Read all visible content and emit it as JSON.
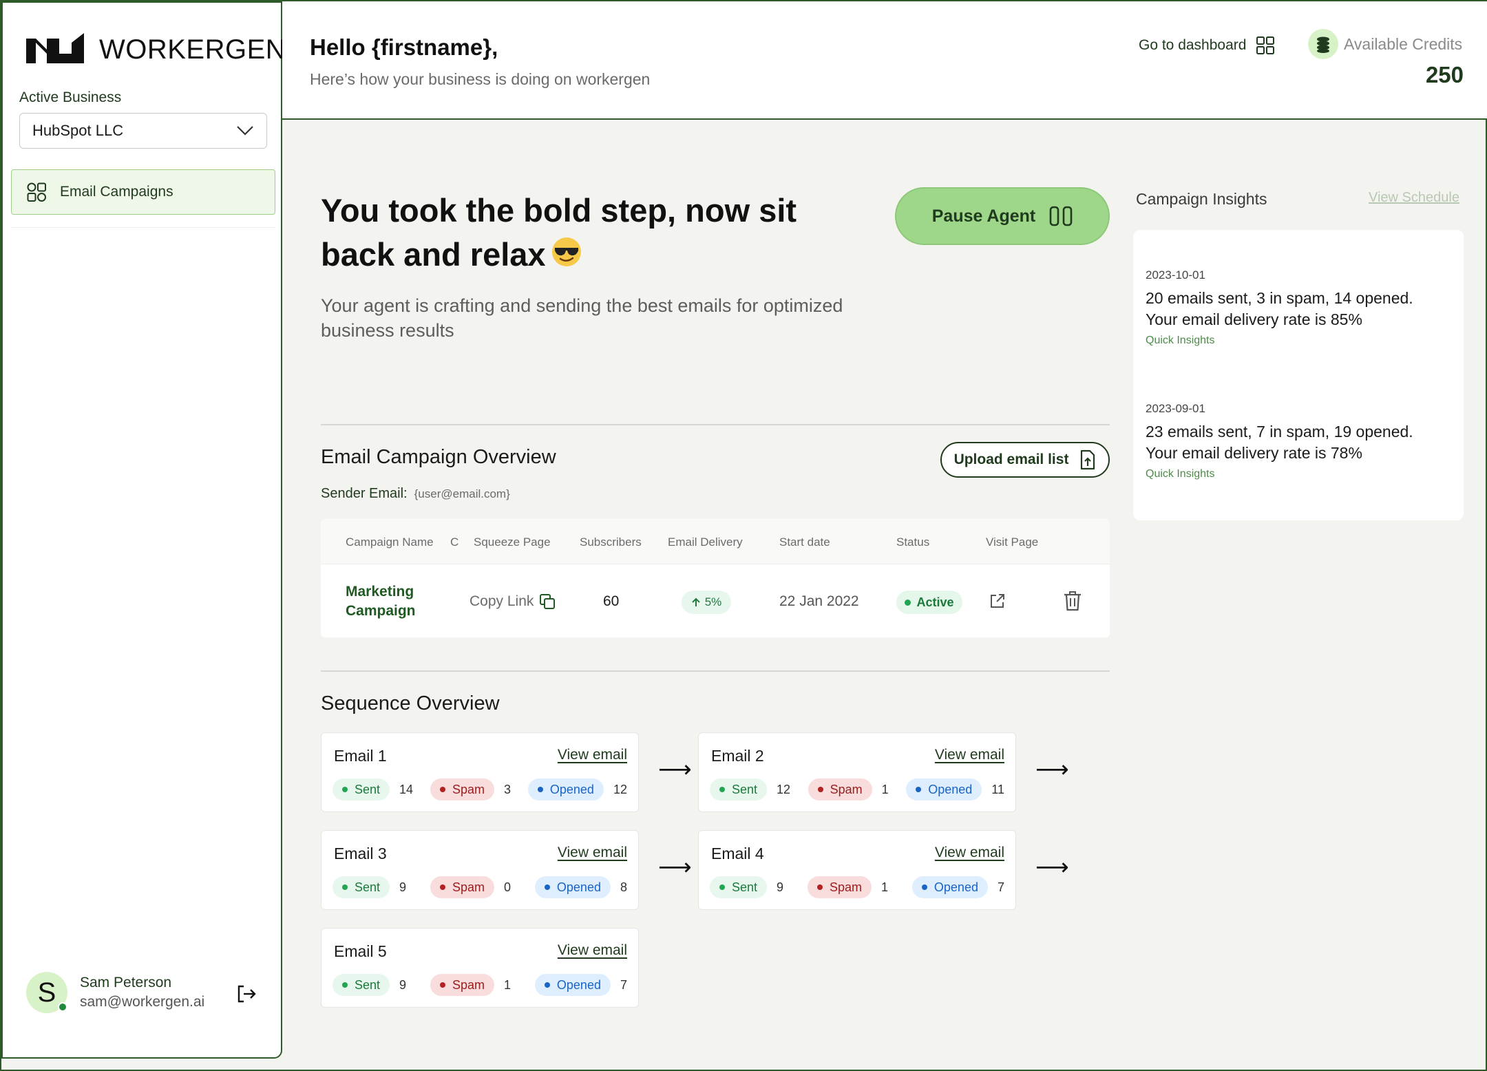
{
  "sidebar": {
    "logo_text": "WORKERGEN",
    "logo_tm": "™",
    "active_business_label": "Active Business",
    "business_selected": "HubSpot LLC",
    "nav_items": [
      {
        "label": "Email Campaigns",
        "icon": "grid-icon"
      }
    ],
    "user": {
      "initial": "S",
      "name": "Sam Peterson",
      "email": "sam@workergen.ai"
    }
  },
  "header": {
    "greeting": "Hello {firstname},",
    "subtitle": "Here’s how your business is doing on workergen",
    "dashboard_link": "Go to dashboard",
    "credits_label": "Available Credits",
    "credits_value": "250"
  },
  "hero": {
    "title": "You took the bold step, now sit back and relax",
    "emoji": "😎",
    "subtitle": "Your agent is crafting and sending the best emails for optimized business results",
    "pause_button": "Pause Agent"
  },
  "campaign_overview": {
    "title": "Email Campaign Overview",
    "sender_label": "Sender Email:",
    "sender_value": "{user@email.com}",
    "upload_button": "Upload email list",
    "columns": [
      "Campaign Name",
      "C",
      "Squeeze Page",
      "Subscribers",
      "Email Delivery",
      "Start date",
      "Status",
      "Visit Page"
    ],
    "rows": [
      {
        "name": "Marketing Campaign",
        "squeeze": "Copy Link",
        "subscribers": "60",
        "delivery": "5%",
        "start_date": "22 Jan 2022",
        "status": "Active"
      }
    ]
  },
  "insights": {
    "title": "Campaign Insights",
    "view_schedule": "View Schedule",
    "items": [
      {
        "date": "2023-10-01",
        "line1": "20 emails sent, 3 in spam, 14 opened.",
        "line2": "Your email delivery rate is 85%",
        "tag": "Quick Insights"
      },
      {
        "date": "2023-09-01",
        "line1": "23 emails sent, 7 in spam, 19 opened.",
        "line2": "Your email delivery rate is 78%",
        "tag": "Quick Insights"
      }
    ]
  },
  "sequence": {
    "title": "Sequence Overview",
    "view_label": "View email",
    "sent_label": "Sent",
    "spam_label": "Spam",
    "opened_label": "Opened",
    "emails": [
      {
        "title": "Email 1",
        "sent": "14",
        "spam": "3",
        "opened": "12"
      },
      {
        "title": "Email 2",
        "sent": "12",
        "spam": "1",
        "opened": "11"
      },
      {
        "title": "Email 3",
        "sent": "9",
        "spam": "0",
        "opened": "8"
      },
      {
        "title": "Email 4",
        "sent": "9",
        "spam": "1",
        "opened": "7"
      },
      {
        "title": "Email 5",
        "sent": "9",
        "spam": "1",
        "opened": "7"
      }
    ]
  },
  "colors": {
    "brand_dark": "#1f3a1c",
    "accent_green": "#9ed68a",
    "border_green": "#2f5a2a",
    "background": "#f3f4ef"
  }
}
